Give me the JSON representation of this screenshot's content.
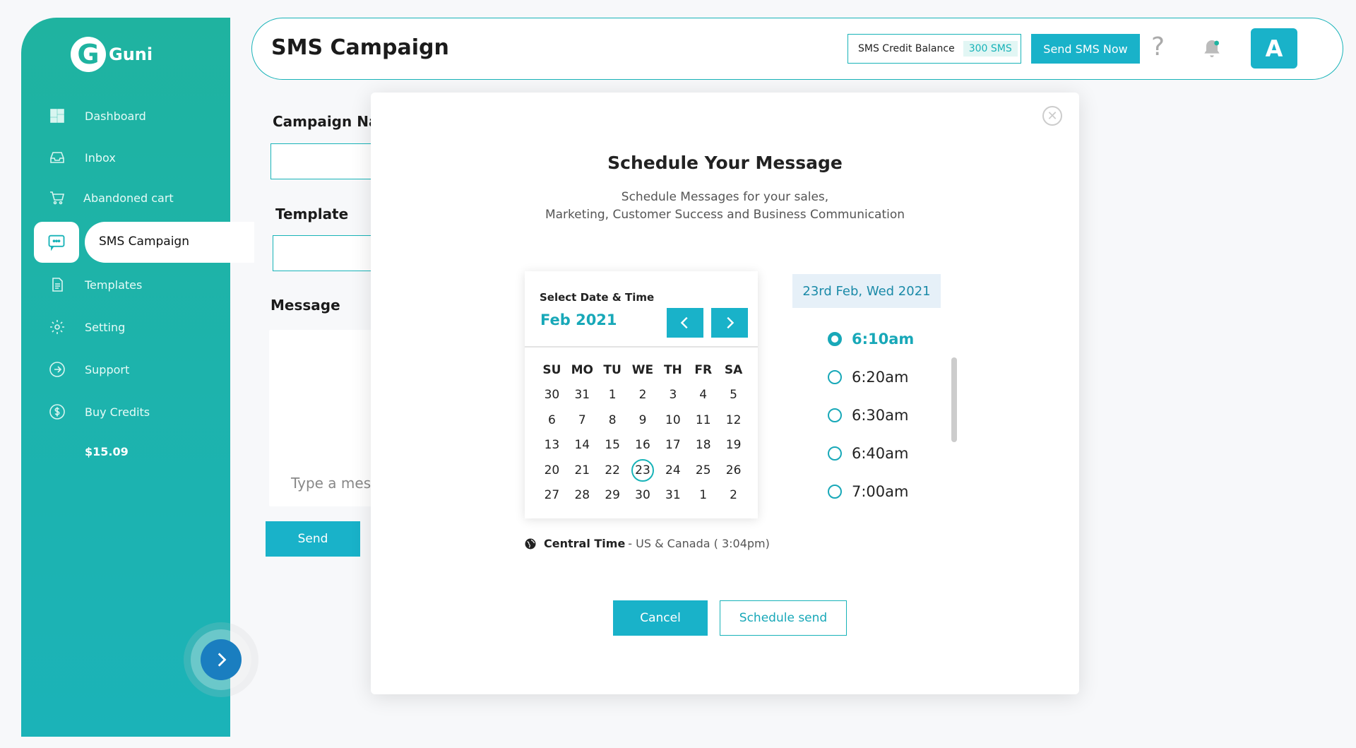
{
  "brand": {
    "logo_letter": "G",
    "name": "Guni"
  },
  "sidebar": {
    "items": [
      {
        "label": "Dashboard",
        "icon": "dashboard-icon"
      },
      {
        "label": "Inbox",
        "icon": "inbox-icon"
      },
      {
        "label": "Abandoned cart",
        "icon": "cart-icon"
      },
      {
        "label": "SMS Campaign",
        "icon": "chat-icon",
        "active": true
      },
      {
        "label": "Templates",
        "icon": "document-icon"
      },
      {
        "label": "Setting",
        "icon": "gear-icon"
      },
      {
        "label": "Support",
        "icon": "arrow-circle-icon"
      },
      {
        "label": "Buy Credits",
        "icon": "dollar-icon"
      }
    ],
    "credits_amount": "$15.09"
  },
  "header": {
    "title": "SMS Campaign",
    "credit_label": "SMS Credit Balance",
    "credit_value": "300 SMS",
    "send_now": "Send SMS Now",
    "help": "?",
    "avatar_letter": "A"
  },
  "form": {
    "campaign_name_label": "Campaign Na",
    "template_label": "Template",
    "message_label": "Message",
    "message_placeholder": "Type a mes",
    "send_label": "Send"
  },
  "modal": {
    "title": "Schedule Your Message",
    "subtitle_line1": "Schedule Messages for your sales,",
    "subtitle_line2": "Marketing, Customer Success and Business Communication",
    "calendar": {
      "header": "Select Date & Time",
      "month": "Feb 2021",
      "days_of_week": [
        "SU",
        "MO",
        "TU",
        "WE",
        "TH",
        "FR",
        "SA"
      ],
      "weeks": [
        [
          "30",
          "31",
          "1",
          "2",
          "3",
          "4",
          "5"
        ],
        [
          "6",
          "7",
          "8",
          "9",
          "10",
          "11",
          "12"
        ],
        [
          "13",
          "14",
          "15",
          "16",
          "17",
          "18",
          "19"
        ],
        [
          "20",
          "21",
          "22",
          "23",
          "24",
          "25",
          "26"
        ],
        [
          "27",
          "28",
          "29",
          "30",
          "31",
          "1",
          "2"
        ]
      ],
      "selected_day": "23"
    },
    "timezone_name": "Central Time",
    "timezone_rest": "- US & Canada ( 3:04pm)",
    "selected_date": "23rd Feb, Wed 2021",
    "time_slots": [
      {
        "time": "6:10am",
        "selected": true
      },
      {
        "time": "6:20am",
        "selected": false
      },
      {
        "time": "6:30am",
        "selected": false
      },
      {
        "time": "6:40am",
        "selected": false
      },
      {
        "time": "7:00am",
        "selected": false
      }
    ],
    "cancel_label": "Cancel",
    "schedule_label": "Schedule send"
  },
  "colors": {
    "accent": "#19b2c9",
    "sidebar_top": "#1fb3a0",
    "sidebar_bottom": "#1bb3b8",
    "navy": "#1a7ec0"
  }
}
